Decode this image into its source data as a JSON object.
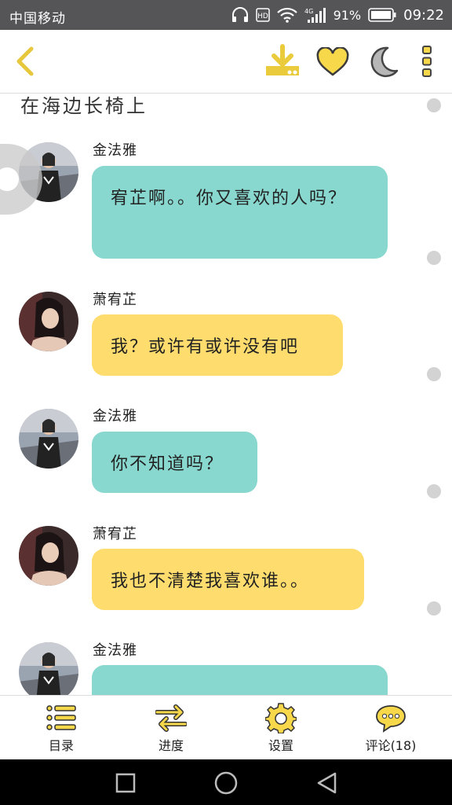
{
  "status_bar": {
    "carrier": "中国移动",
    "battery_percent": "91%",
    "time": "09:22"
  },
  "toolbar": {
    "back_icon": "back-arrow-icon",
    "download_icon": "download-icon",
    "favorite_icon": "heart-icon",
    "night_icon": "moon-icon",
    "more_icon": "more-vertical-icon"
  },
  "content": {
    "previous_line": "在海边长椅上",
    "messages": [
      {
        "sender": "金法雅",
        "text": "宥芷啊。。你又喜欢的人吗？",
        "style": "teal"
      },
      {
        "sender": "萧宥芷",
        "text": "我？或许有或许没有吧",
        "style": "yellow"
      },
      {
        "sender": "金法雅",
        "text": "你不知道吗？",
        "style": "teal"
      },
      {
        "sender": "萧宥芷",
        "text": "我也不清楚我喜欢谁。。",
        "style": "yellow"
      },
      {
        "sender": "金法雅",
        "text": "",
        "style": "teal"
      }
    ]
  },
  "bottom_tabs": [
    {
      "label": "目录",
      "icon": "list-icon"
    },
    {
      "label": "进度",
      "icon": "progress-arrows-icon"
    },
    {
      "label": "设置",
      "icon": "gear-icon"
    },
    {
      "label": "评论(18)",
      "icon": "comment-icon"
    }
  ],
  "colors": {
    "accent_yellow": "#fedc6d",
    "bubble_teal": "#88d8cf",
    "icon_yellow": "#f6d84a"
  }
}
